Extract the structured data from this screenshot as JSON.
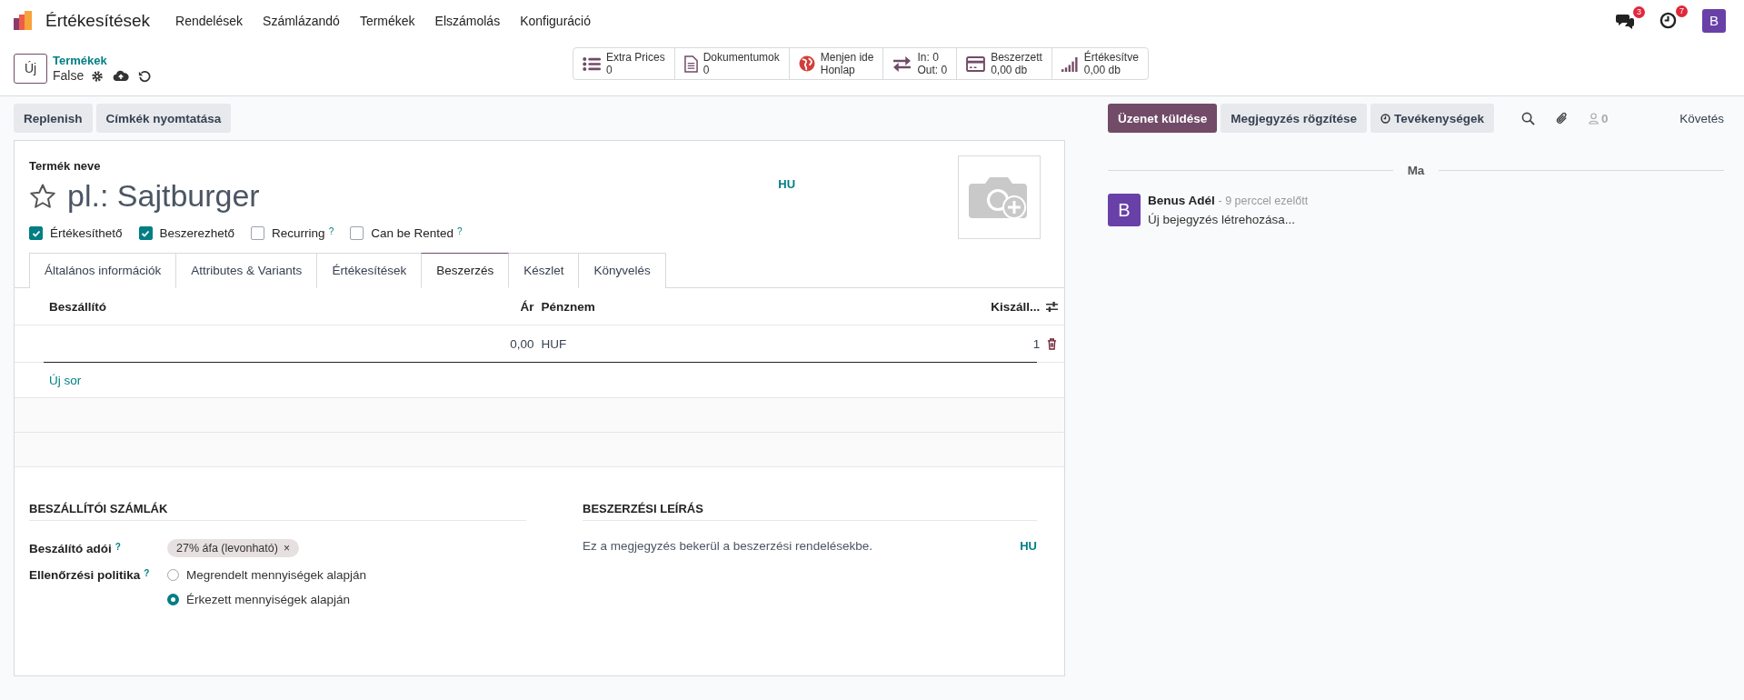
{
  "nav": {
    "app": "Értékesítések",
    "menus": [
      "Rendelések",
      "Számlázandó",
      "Termékek",
      "Elszámolás",
      "Konfiguráció"
    ],
    "messages_badge": "3",
    "activities_badge": "7",
    "avatar": "B"
  },
  "control": {
    "new_button": "Új",
    "breadcrumb": "Termékek",
    "record": "False"
  },
  "stat_buttons": [
    {
      "kind": "list",
      "lines": [
        "Extra Prices",
        "0"
      ]
    },
    {
      "kind": "document",
      "lines": [
        "Dokumentumok",
        "0"
      ]
    },
    {
      "kind": "globe",
      "lines": [
        "Menjen ide",
        "Honlap"
      ]
    },
    {
      "kind": "transfer",
      "lines": [
        "In: 0",
        "Out: 0"
      ]
    },
    {
      "kind": "card",
      "lines": [
        "Beszerzett",
        "0,00 db"
      ]
    },
    {
      "kind": "bars",
      "lines": [
        "Értékesítve",
        "0,00 db"
      ]
    }
  ],
  "actions": [
    "Replenish",
    "Címkék nyomtatása"
  ],
  "form": {
    "name_label": "Termék neve",
    "name_placeholder": "pl.: Sajtburger",
    "starred": false,
    "lang": "HU",
    "checks": [
      {
        "label": "Értékesíthető",
        "checked": true
      },
      {
        "label": "Beszerezhető",
        "checked": true
      },
      {
        "label": "Recurring",
        "checked": false,
        "help": "?"
      },
      {
        "label": "Can be Rented",
        "checked": false,
        "help": "?"
      }
    ],
    "tabs": [
      {
        "label": "Általános információk",
        "selected": false
      },
      {
        "label": "Attributes & Variants",
        "selected": false
      },
      {
        "label": "Értékesítések",
        "selected": false
      },
      {
        "label": "Beszerzés",
        "selected": true
      },
      {
        "label": "Készlet",
        "selected": false
      },
      {
        "label": "Könyvelés",
        "selected": false
      }
    ],
    "table": {
      "columns": [
        "Beszállító",
        "Ár",
        "Pénznem",
        "Kiszáll..."
      ],
      "rows": [
        {
          "price": "0,00",
          "currency": "HUF",
          "qty": "1"
        }
      ],
      "add_line": "Új sor"
    },
    "vendor_bills": {
      "title": "BESZÁLLÍTÓI SZÁMLÁK",
      "taxes_label": "Beszálító adói",
      "taxes_help": "?",
      "tax_tag": "27% áfa (levonható)",
      "tag_remove": "×",
      "policy_label": "Ellenőrzési politika",
      "policy_help": "?",
      "policy_options": [
        {
          "label": "Megrendelt mennyiségek alapján",
          "selected": false
        },
        {
          "label": "Érkezett mennyiségek alapján",
          "selected": true
        }
      ]
    },
    "purchase_description": {
      "title": "BESZERZÉSI LEÍRÁS",
      "placeholder": "Ez a megjegyzés bekerül a beszerzési rendelésekbe.",
      "lang": "HU"
    }
  },
  "chatter": {
    "send": "Üzenet küldése",
    "log": "Megjegyzés rögzítése",
    "activities": "Tevékenységek",
    "followers": "0",
    "follow": "Követés",
    "date": "Ma",
    "messages": [
      {
        "avatar": "B",
        "author": "Benus Adél",
        "time": "- 9 perccel ezelőtt",
        "body": "Új bejegyzés létrehozása..."
      }
    ]
  }
}
